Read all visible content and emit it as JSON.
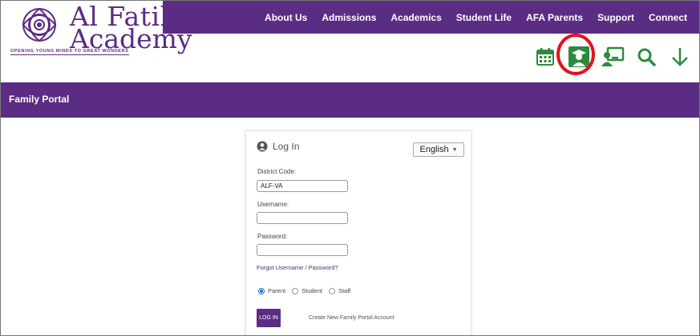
{
  "brand": {
    "name_line1": "Al Fatih",
    "name_line2": "Academy",
    "tagline": "OPENING YOUNG MINDS TO GREAT WONDERS",
    "accent_color": "#5b2c83"
  },
  "topnav": {
    "items": [
      "About Us",
      "Admissions",
      "Academics",
      "Student Life",
      "AFA Parents",
      "Support",
      "Connect"
    ]
  },
  "iconbar": {
    "icons": [
      "calendar-icon",
      "student-portal-icon",
      "teacher-portal-icon",
      "search-icon",
      "arrow-down-icon"
    ],
    "highlighted": "student-portal-icon",
    "highlight_color": "#e4121c",
    "icon_color": "#2d8a3e"
  },
  "portal": {
    "title": "Family Portal"
  },
  "login": {
    "header": "Log In",
    "language": "English",
    "district_label": "District Code:",
    "district_value": "ALF-VA",
    "username_label": "Username:",
    "username_value": "",
    "password_label": "Password:",
    "password_value": "",
    "forgot_link": "Forgot Username / Password?",
    "roles": [
      "Parent",
      "Student",
      "Staff"
    ],
    "selected_role": "Parent",
    "login_button": "LOG IN",
    "create_link": "Create New Family Portal Account"
  }
}
